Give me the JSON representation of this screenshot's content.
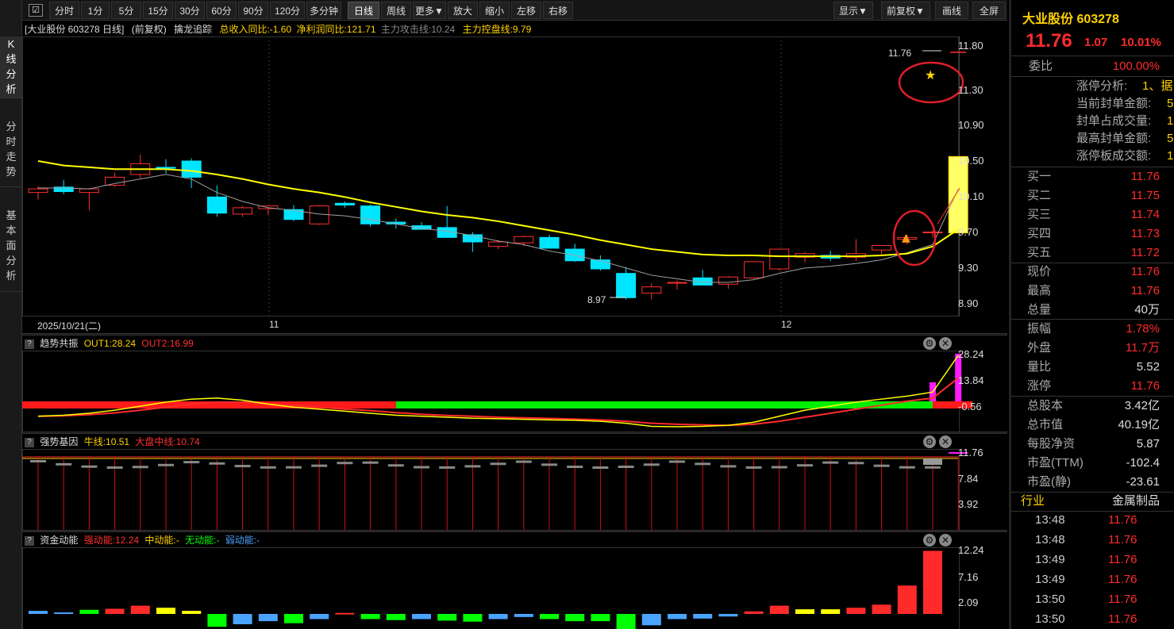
{
  "left_nav": [
    {
      "label": "K线分析",
      "chars": [
        "K",
        "线",
        "分",
        "析"
      ],
      "active": true
    },
    {
      "label": "分时走势",
      "chars": [
        "分",
        "时",
        "走",
        "势"
      ],
      "active": false
    },
    {
      "label": "基本面分析",
      "chars": [
        "基",
        "本",
        "面",
        "分",
        "析"
      ],
      "active": false
    }
  ],
  "toolbar": {
    "items": [
      "分时",
      "1分",
      "5分",
      "15分",
      "30分",
      "60分",
      "90分",
      "120分",
      "多分钟",
      "日线",
      "周线",
      "更多▼",
      "放大",
      "缩小",
      "左移",
      "右移"
    ],
    "active": "日线",
    "right_items": [
      "显示▼",
      "前复权▼",
      "画线",
      "全屏"
    ]
  },
  "chart": {
    "title": "[大业股份 603278 日线]",
    "adjust": "(前复权)",
    "indicator_name": "擒龙追踪",
    "revenue_yoy": "总收入同比:-1.60",
    "profit_yoy": "净利润同比:121.71",
    "attack_line": "主力攻击线:10.24",
    "control_line": "主力控盘线:9.79",
    "y_labels": [
      "11.80",
      "11.30",
      "10.90",
      "10.50",
      "10.10",
      "9.70",
      "9.30",
      "8.90"
    ],
    "x_labels": [
      "2025/10/21(二)",
      "11",
      "12"
    ],
    "high_marker": "11.76",
    "low_marker": "8.97",
    "colors": {
      "up": "#ff3030",
      "down": "#00e5ff",
      "ma_yellow": "#ffff00",
      "ma_gray": "#a0a0a0"
    }
  },
  "chart_data": {
    "type": "candlestick",
    "x": [
      "D1",
      "D2",
      "D3",
      "D4",
      "D5",
      "D6",
      "D7",
      "D8",
      "D9",
      "D10",
      "D11",
      "D12",
      "D13",
      "D14",
      "D15",
      "D16",
      "D17",
      "D18",
      "D19",
      "D20",
      "D21",
      "D22",
      "D23",
      "D24",
      "D25",
      "D26",
      "D27",
      "D28",
      "D29",
      "D30",
      "D31",
      "D32",
      "D33",
      "D34",
      "D35",
      "D36",
      "D37"
    ],
    "ohlc": [
      [
        10.2,
        10.27,
        10.12,
        10.24
      ],
      [
        10.26,
        10.34,
        10.18,
        10.21
      ],
      [
        10.2,
        10.25,
        10.0,
        10.24
      ],
      [
        10.28,
        10.42,
        10.26,
        10.37
      ],
      [
        10.4,
        10.62,
        10.36,
        10.52
      ],
      [
        10.48,
        10.57,
        10.41,
        10.47
      ],
      [
        10.55,
        10.58,
        10.25,
        10.37
      ],
      [
        10.15,
        10.28,
        9.93,
        9.97
      ],
      [
        9.96,
        10.05,
        9.93,
        10.03
      ],
      [
        10.02,
        10.06,
        9.95,
        10.05
      ],
      [
        10.01,
        10.06,
        9.88,
        9.9
      ],
      [
        9.85,
        10.06,
        9.84,
        10.05
      ],
      [
        10.08,
        10.1,
        10.03,
        10.06
      ],
      [
        10.05,
        10.07,
        9.82,
        9.85
      ],
      [
        9.87,
        9.91,
        9.8,
        9.85
      ],
      [
        9.83,
        9.87,
        9.79,
        9.79
      ],
      [
        9.81,
        10.05,
        9.71,
        9.7
      ],
      [
        9.73,
        9.76,
        9.54,
        9.65
      ],
      [
        9.6,
        9.67,
        9.57,
        9.65
      ],
      [
        9.64,
        9.72,
        9.6,
        9.71
      ],
      [
        9.7,
        9.73,
        9.58,
        9.58
      ],
      [
        9.57,
        9.63,
        9.43,
        9.44
      ],
      [
        9.45,
        9.5,
        9.33,
        9.35
      ],
      [
        9.3,
        9.37,
        9.01,
        9.03
      ],
      [
        9.08,
        9.19,
        9.01,
        9.15
      ],
      [
        9.19,
        9.22,
        9.12,
        9.2
      ],
      [
        9.25,
        9.34,
        9.19,
        9.17
      ],
      [
        9.18,
        9.27,
        9.13,
        9.26
      ],
      [
        9.25,
        9.36,
        9.24,
        9.43
      ],
      [
        9.35,
        9.57,
        9.33,
        9.57
      ],
      [
        9.48,
        9.54,
        9.42,
        9.52
      ],
      [
        9.5,
        9.55,
        9.44,
        9.47
      ],
      [
        9.48,
        9.68,
        9.44,
        9.52
      ],
      [
        9.56,
        9.61,
        9.5,
        9.61
      ],
      [
        9.68,
        9.73,
        9.62,
        9.7
      ],
      [
        9.76,
        9.78,
        9.7,
        9.76
      ],
      [
        11.76,
        11.76,
        11.76,
        11.76
      ]
    ],
    "ma_yellow": [
      10.55,
      10.5,
      10.48,
      10.46,
      10.46,
      10.46,
      10.44,
      10.4,
      10.35,
      10.29,
      10.24,
      10.2,
      10.15,
      10.09,
      10.04,
      9.99,
      9.95,
      9.92,
      9.88,
      9.83,
      9.78,
      9.73,
      9.67,
      9.62,
      9.57,
      9.54,
      9.51,
      9.5,
      9.5,
      9.49,
      9.49,
      9.49,
      9.49,
      9.5,
      9.52,
      9.6,
      9.79
    ],
    "ma_gray": [
      10.25,
      10.25,
      10.24,
      10.3,
      10.35,
      10.4,
      10.35,
      10.2,
      10.1,
      10.03,
      10.0,
      9.96,
      9.94,
      9.9,
      9.85,
      9.8,
      9.77,
      9.72,
      9.66,
      9.62,
      9.55,
      9.5,
      9.44,
      9.36,
      9.28,
      9.24,
      9.2,
      9.2,
      9.23,
      9.3,
      9.36,
      9.38,
      9.41,
      9.45,
      9.53,
      9.62,
      10.24
    ],
    "ylim": [
      8.9,
      11.9
    ]
  },
  "ind1": {
    "name": "趋势共振",
    "out1": "OUT1:28.24",
    "out2": "OUT2:16.99",
    "y_labels": [
      "28.24",
      "13.84",
      "-0.56"
    ],
    "out1_series": [
      -2.0,
      -1.5,
      -0.5,
      1.0,
      3.0,
      5.0,
      6.5,
      7.0,
      6.0,
      4.0,
      2.5,
      1.5,
      0.5,
      -0.5,
      -1.5,
      -2.0,
      -2.5,
      -3.0,
      -3.2,
      -3.5,
      -3.8,
      -4.0,
      -4.5,
      -5.5,
      -7.0,
      -7.2,
      -7.0,
      -6.5,
      -5.0,
      -2.0,
      1.0,
      3.0,
      5.0,
      6.5,
      8.0,
      10.0,
      28.24
    ],
    "out2_series": [
      -2.0,
      -1.8,
      -1.2,
      -0.3,
      1.0,
      2.5,
      4.0,
      5.0,
      5.0,
      4.2,
      3.3,
      2.5,
      1.5,
      0.8,
      -0.2,
      -1.0,
      -1.6,
      -2.0,
      -2.5,
      -2.8,
      -3.1,
      -3.4,
      -3.8,
      -4.5,
      -5.5,
      -6.0,
      -6.3,
      -6.5,
      -6.0,
      -4.5,
      -2.5,
      -0.5,
      1.5,
      3.5,
      5.5,
      7.0,
      16.99
    ],
    "bar_red_until": 14
  },
  "ind2": {
    "name": "强势基因",
    "bull_line": "牛线:10.51",
    "market_mid": "大盘中线:10.74",
    "y_labels": [
      "11.76",
      "7.84",
      "3.92"
    ]
  },
  "ind3": {
    "name": "资金动能",
    "strong": "强动能:12.24",
    "mid": "中动能:-",
    "none": "无动能:-",
    "weak": "弱动能:-",
    "y_labels": [
      "12.24",
      "7.16",
      "2.09"
    ],
    "bars": [
      {
        "v": 0.6,
        "c": "#4aa3ff"
      },
      {
        "v": 0.3,
        "c": "#4aa3ff"
      },
      {
        "v": 0.8,
        "c": "#00ff00"
      },
      {
        "v": 1.0,
        "c": "#ff2b2b"
      },
      {
        "v": 1.6,
        "c": "#ff2b2b"
      },
      {
        "v": 1.2,
        "c": "#ffff00"
      },
      {
        "v": 0.6,
        "c": "#ffff00"
      },
      {
        "v": -2.5,
        "c": "#00ff00"
      },
      {
        "v": -2.0,
        "c": "#4aa3ff"
      },
      {
        "v": -1.4,
        "c": "#4aa3ff"
      },
      {
        "v": -1.8,
        "c": "#00ff00"
      },
      {
        "v": -1.0,
        "c": "#4aa3ff"
      },
      {
        "v": 0.2,
        "c": "#ff2b2b"
      },
      {
        "v": -1.0,
        "c": "#00ff00"
      },
      {
        "v": -1.2,
        "c": "#00ff00"
      },
      {
        "v": -1.0,
        "c": "#4aa3ff"
      },
      {
        "v": -1.3,
        "c": "#00ff00"
      },
      {
        "v": -1.5,
        "c": "#00ff00"
      },
      {
        "v": -1.0,
        "c": "#4aa3ff"
      },
      {
        "v": -0.6,
        "c": "#4aa3ff"
      },
      {
        "v": -1.0,
        "c": "#00ff00"
      },
      {
        "v": -1.4,
        "c": "#00ff00"
      },
      {
        "v": -1.4,
        "c": "#00ff00"
      },
      {
        "v": -3.0,
        "c": "#00ff00"
      },
      {
        "v": -2.2,
        "c": "#4aa3ff"
      },
      {
        "v": -1.0,
        "c": "#4aa3ff"
      },
      {
        "v": -0.9,
        "c": "#4aa3ff"
      },
      {
        "v": -0.5,
        "c": "#4aa3ff"
      },
      {
        "v": 0.5,
        "c": "#ff2b2b"
      },
      {
        "v": 1.6,
        "c": "#ff2b2b"
      },
      {
        "v": 0.9,
        "c": "#ffff00"
      },
      {
        "v": 0.9,
        "c": "#ffff00"
      },
      {
        "v": 1.2,
        "c": "#ff2b2b"
      },
      {
        "v": 1.8,
        "c": "#ff2b2b"
      },
      {
        "v": 5.5,
        "c": "#ff2b2b"
      },
      {
        "v": 12.24,
        "c": "#ff2b2b"
      }
    ]
  },
  "quote": {
    "name_code": "大业股份 603278",
    "price": "11.76",
    "change": "1.07",
    "pct": "10.01%",
    "weibi_label": "委比",
    "weibi": "100.00%",
    "zt_rows": [
      {
        "label": "涨停分析:",
        "val": "1、据"
      },
      {
        "label": "当前封单金额:",
        "val": "5."
      },
      {
        "label": "封单占成交量:",
        "val": "1"
      },
      {
        "label": "最高封单金额:",
        "val": "5."
      },
      {
        "label": "涨停板成交额:",
        "val": "1."
      }
    ],
    "bids": [
      {
        "label": "买一",
        "val": "11.76"
      },
      {
        "label": "买二",
        "val": "11.75"
      },
      {
        "label": "买三",
        "val": "11.74"
      },
      {
        "label": "买四",
        "val": "11.73"
      },
      {
        "label": "买五",
        "val": "11.72"
      }
    ],
    "stats1": [
      {
        "label": "现价",
        "val": "11.76",
        "cls": "red"
      },
      {
        "label": "最高",
        "val": "11.76",
        "cls": "red"
      },
      {
        "label": "总量",
        "val": "40万",
        "cls": "white"
      }
    ],
    "stats2": [
      {
        "label": "振幅",
        "val": "1.78%",
        "cls": "red"
      },
      {
        "label": "外盘",
        "val": "11.7万",
        "cls": "red"
      },
      {
        "label": "量比",
        "val": "5.52",
        "cls": "white"
      },
      {
        "label": "涨停",
        "val": "11.76",
        "cls": "red"
      }
    ],
    "stats3": [
      {
        "label": "总股本",
        "val": "3.42亿"
      },
      {
        "label": "总市值",
        "val": "40.19亿"
      },
      {
        "label": "每股净资",
        "val": "5.87"
      },
      {
        "label": "市盈(TTM)",
        "val": "-102.4"
      },
      {
        "label": "市盈(静)",
        "val": "-23.61"
      }
    ],
    "industry_label": "行业",
    "industry": "金属制品",
    "ticks": [
      {
        "t": "13:48",
        "p": "11.76"
      },
      {
        "t": "13:48",
        "p": "11.76"
      },
      {
        "t": "13:49",
        "p": "11.76"
      },
      {
        "t": "13:49",
        "p": "11.76"
      },
      {
        "t": "13:50",
        "p": "11.76"
      },
      {
        "t": "13:50",
        "p": "11.76"
      }
    ]
  }
}
